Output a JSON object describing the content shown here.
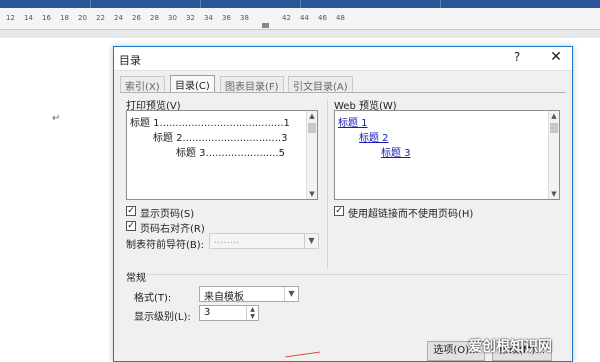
{
  "ruler": {
    "ticks": [
      "12",
      "14",
      "16",
      "18",
      "20",
      "22",
      "24",
      "26",
      "28",
      "30",
      "32",
      "34",
      "36",
      "38",
      "42",
      "44",
      "46",
      "48"
    ]
  },
  "doc": {
    "paragraph_mark": "↵"
  },
  "dialog": {
    "title": "目录",
    "help": "?",
    "close": "✕",
    "tabs": [
      "索引(X)",
      "目录(C)",
      "图表目录(F)",
      "引文目录(A)"
    ],
    "active_tab": 1,
    "print_preview": {
      "label": "打印预览(V)",
      "lines": [
        "标题 1.......................................1",
        "标题 2...............................3",
        "标题 3.......................5"
      ]
    },
    "web_preview": {
      "label": "Web 预览(W)",
      "links": [
        "标题 1",
        "标题 2",
        "标题 3"
      ]
    },
    "show_page_numbers": {
      "label": "显示页码(S)",
      "checked": true
    },
    "right_align": {
      "label": "页码右对齐(R)",
      "checked": true
    },
    "tab_leader": {
      "label": "制表符前导符(B):",
      "value": "........"
    },
    "use_hyperlinks": {
      "label": "使用超链接而不使用页码(H)",
      "checked": true
    },
    "general": {
      "heading": "常规",
      "format_label": "格式(T):",
      "format_value": "来自模板",
      "levels_label": "显示级别(L):",
      "levels_value": "3"
    },
    "buttons": {
      "options": "选项(O)...",
      "modify": "修改(M)..."
    }
  },
  "watermark": "爱创根知识网"
}
